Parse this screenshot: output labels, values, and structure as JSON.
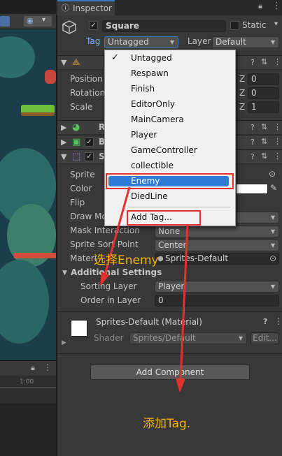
{
  "scene": {
    "timeline_tick": "1:00"
  },
  "inspector": {
    "tab_label": "Inspector",
    "object_name": "Square",
    "static_label": "Static",
    "tag_label": "Tag",
    "tag_value": "Untagged",
    "layer_label": "Layer",
    "layer_value": "Default"
  },
  "transform": {
    "position_label": "Position",
    "rotation_label": "Rotation",
    "scale_label": "Scale",
    "axis_label": "Z",
    "position_z": "0",
    "rotation_z": "0",
    "scale_z": "1"
  },
  "components": {
    "row1_initial": "R",
    "row2_initial": "B",
    "row3_initial": "S"
  },
  "sprite_renderer": {
    "sprite_label": "Sprite",
    "color_label": "Color",
    "flip_label": "Flip",
    "draw_mode_label": "Draw Mo",
    "mask_label": "Mask Interaction",
    "mask_value": "None",
    "sort_point_label": "Sprite Sort Point",
    "sort_point_value": "Center",
    "material_label": "Materi",
    "material_value": "Sprites-Default",
    "additional_settings": "Additional Settings",
    "sorting_layer_label": "Sorting Layer",
    "sorting_layer_value": "Player",
    "order_label": "Order in Layer",
    "order_value": "0"
  },
  "material": {
    "name": "Sprites-Default (Material)",
    "shader_label": "Shader",
    "shader_value": "Sprites/Default",
    "edit_label": "Edit..."
  },
  "add_component_label": "Add Component",
  "tag_menu": {
    "items": [
      "Untagged",
      "Respawn",
      "Finish",
      "EditorOnly",
      "MainCamera",
      "Player",
      "GameController",
      "collectible",
      "Enemy",
      "DiedLine"
    ],
    "checked_item": "Untagged",
    "selected_item": "Enemy",
    "add_tag": "Add Tag..."
  },
  "annotations": {
    "select_enemy": "选择Enemy",
    "add_tag": "添加Tag."
  },
  "colors": {
    "annotation_red": "#e53030",
    "annotation_text": "#f5b400",
    "selection_blue": "#2f7bd4"
  }
}
